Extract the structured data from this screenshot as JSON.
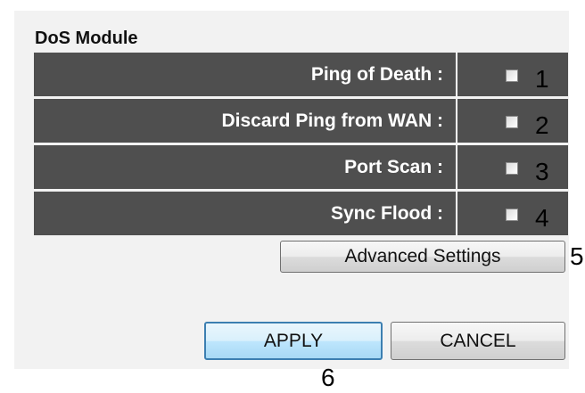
{
  "section_title": "DoS Module",
  "rows": [
    {
      "label": "Ping of Death :",
      "checked": false,
      "annotation": "1"
    },
    {
      "label": "Discard Ping from WAN :",
      "checked": false,
      "annotation": "2"
    },
    {
      "label": "Port Scan :",
      "checked": false,
      "annotation": "3"
    },
    {
      "label": "Sync Flood :",
      "checked": false,
      "annotation": "4"
    }
  ],
  "advanced_button": {
    "label": "Advanced Settings",
    "annotation": "5"
  },
  "apply_button": {
    "label": "APPLY",
    "annotation": "6"
  },
  "cancel_button": {
    "label": "CANCEL"
  }
}
